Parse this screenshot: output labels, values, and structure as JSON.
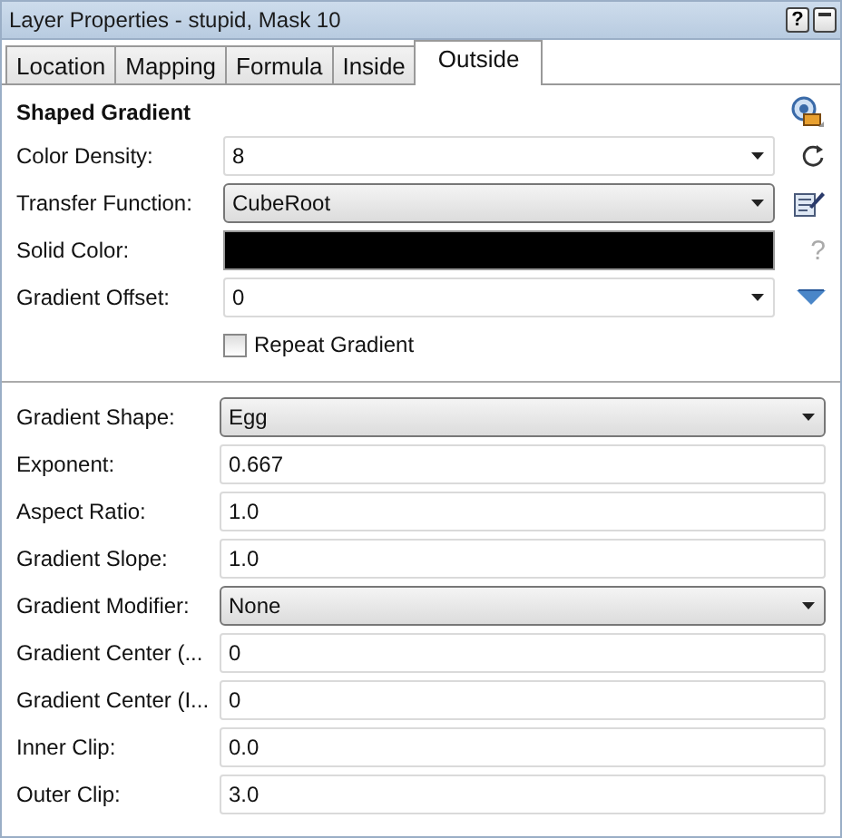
{
  "window": {
    "title": "Layer Properties - stupid, Mask 10",
    "help_button": "?"
  },
  "tabs": [
    {
      "label": "Location",
      "selected": false
    },
    {
      "label": "Mapping",
      "selected": false
    },
    {
      "label": "Formula",
      "selected": false
    },
    {
      "label": "Inside",
      "selected": false
    },
    {
      "label": "Outside",
      "selected": true
    }
  ],
  "section": {
    "title": "Shaped Gradient"
  },
  "rows": [
    {
      "label": "Color Density:",
      "kind": "combo",
      "value": "8",
      "side": {
        "kind": "refresh"
      }
    },
    {
      "label": "Transfer Function:",
      "kind": "select",
      "value": "CubeRoot",
      "side": {
        "kind": "edit"
      }
    },
    {
      "label": "Solid Color:",
      "kind": "color",
      "color": "#000000",
      "side": {
        "kind": "text",
        "text": "?"
      }
    },
    {
      "label": "Gradient Offset:",
      "kind": "combo",
      "value": "0",
      "side": {
        "kind": "triangle"
      }
    },
    {
      "label": "Repeat Gradient",
      "kind": "checkbox",
      "checked": false
    }
  ],
  "shape_rows": [
    {
      "label": "Gradient Shape:",
      "kind": "select",
      "value": "Egg"
    },
    {
      "label": "Exponent:",
      "kind": "text",
      "value": "0.667"
    },
    {
      "label": "Aspect Ratio:",
      "kind": "text",
      "value": "1.0"
    },
    {
      "label": "Gradient Slope:",
      "kind": "text",
      "value": "1.0"
    },
    {
      "label": "Gradient Modifier:",
      "kind": "select",
      "value": "None"
    },
    {
      "label": "Gradient Center (...",
      "kind": "text",
      "value": "0"
    },
    {
      "label": "Gradient Center (I...",
      "kind": "text",
      "value": "0"
    },
    {
      "label": "Inner Clip:",
      "kind": "text",
      "value": "0.0"
    },
    {
      "label": "Outer Clip:",
      "kind": "text",
      "value": "3.0"
    }
  ]
}
